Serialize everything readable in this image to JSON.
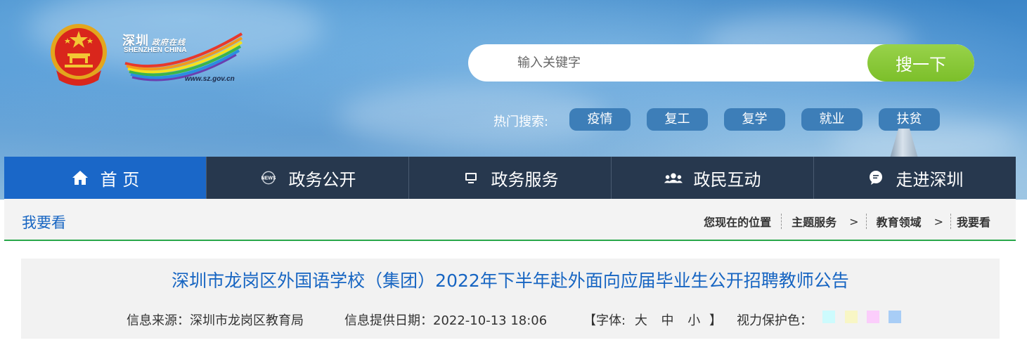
{
  "header": {
    "logo": {
      "name_cn": "深圳",
      "tagline_cn": "政府在线",
      "name_en": "SHENZHEN CHINA",
      "url": "www.sz.gov.cn"
    },
    "search": {
      "placeholder": "输入关键字",
      "button_label": "搜一下"
    },
    "hot_search": {
      "label": "热门搜索:",
      "tags": [
        "疫情",
        "复工",
        "复学",
        "就业",
        "扶贫"
      ]
    }
  },
  "nav": {
    "items": [
      {
        "label": "首 页",
        "icon": "home-icon",
        "active": true
      },
      {
        "label": "政务公开",
        "icon": "news-icon",
        "active": false
      },
      {
        "label": "政务服务",
        "icon": "monitor-icon",
        "active": false
      },
      {
        "label": "政民互动",
        "icon": "people-icon",
        "active": false
      },
      {
        "label": "走进深圳",
        "icon": "chat-bubble-icon",
        "active": false
      }
    ]
  },
  "breadcrumb": {
    "section_title": "我要看",
    "location_label": "您现在的位置",
    "items": [
      "主题服务",
      "教育领域",
      "我要看"
    ],
    "separator": ">"
  },
  "article": {
    "title": "深圳市龙岗区外国语学校（集团）2022年下半年赴外面向应届毕业生公开招聘教师公告",
    "source_label": "信息来源：深圳市龙岗区教育局",
    "date_label": "信息提供日期：2022-10-13 18:06",
    "font_size": {
      "open": "【字体:",
      "large": "大",
      "medium": "中",
      "small": "小",
      "close": "】"
    },
    "eye_care_label": "视力保护色：",
    "eye_care_colors": [
      "#cdfbfd",
      "#f8f6c5",
      "#fbcdfb",
      "#a8cdf6"
    ]
  }
}
